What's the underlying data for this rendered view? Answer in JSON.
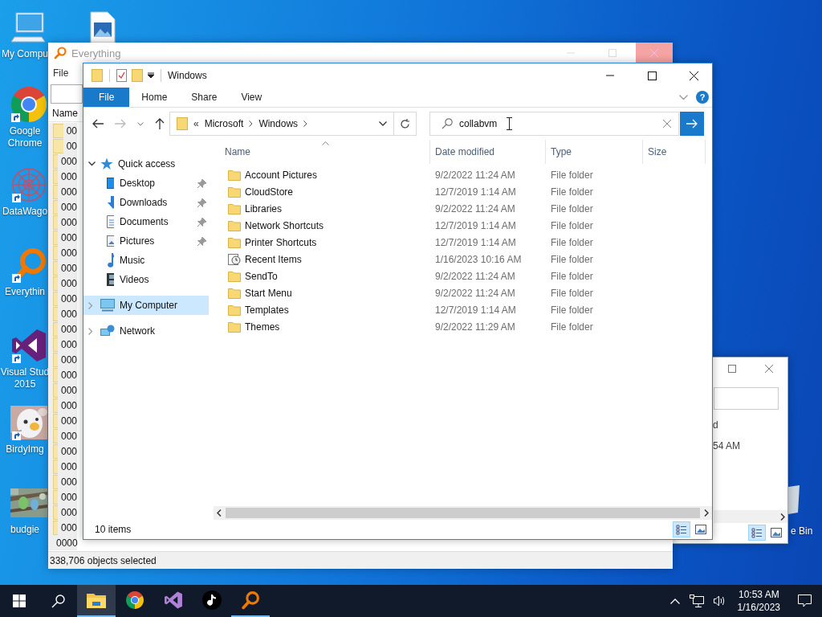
{
  "desktop_icons": [
    {
      "kind": "computer",
      "lines": [
        "My Compu"
      ]
    },
    {
      "kind": "image-file"
    },
    {
      "kind": "chrome",
      "lines": [
        "Google",
        "Chrome"
      ],
      "shortcut": true
    },
    {
      "kind": "datawagon",
      "lines": [
        "DataWago"
      ],
      "shortcut": true
    },
    {
      "kind": "everything",
      "lines": [
        "Everythin"
      ],
      "shortcut": true
    },
    {
      "kind": "visual-studio",
      "lines": [
        "Visual Stud",
        "2015"
      ],
      "shortcut": true
    },
    {
      "kind": "picture",
      "lines": [
        "BirdyImg"
      ],
      "shortcut": true
    },
    {
      "kind": "picture",
      "lines": [
        "budgie"
      ]
    }
  ],
  "recycle_bin": {
    "label": "e Bin"
  },
  "everything_window": {
    "title": "Everything",
    "menu": [
      "File"
    ],
    "column": "Name",
    "rows": [
      {
        "name": "00",
        "selected": true
      },
      {
        "name": "00",
        "selected": true
      },
      {
        "name": "000",
        "selected": true
      },
      {
        "name": "000",
        "selected": true
      },
      {
        "name": "000",
        "selected": true
      },
      {
        "name": "000",
        "selected": true
      },
      {
        "name": "000",
        "selected": true
      },
      {
        "name": "000",
        "selected": true
      },
      {
        "name": "000",
        "selected": true
      },
      {
        "name": "000",
        "selected": true
      },
      {
        "name": "000",
        "selected": true
      },
      {
        "name": "000",
        "selected": true
      },
      {
        "name": "000",
        "selected": true
      },
      {
        "name": "000",
        "selected": true
      },
      {
        "name": "000",
        "selected": true
      },
      {
        "name": "000",
        "selected": true
      },
      {
        "name": "000",
        "selected": true
      },
      {
        "name": "000",
        "selected": true
      },
      {
        "name": "000",
        "selected": true
      },
      {
        "name": "000",
        "selected": true
      },
      {
        "name": "000",
        "selected": true
      },
      {
        "name": "000",
        "selected": true
      },
      {
        "name": "000",
        "selected": true
      },
      {
        "name": "000",
        "selected": true
      },
      {
        "name": "000",
        "selected": true
      },
      {
        "name": "000",
        "selected": true
      },
      {
        "name": "000",
        "selected": true
      },
      {
        "name": "0000",
        "selected": true
      }
    ],
    "status": "338,706 objects selected"
  },
  "back_window": {
    "texts": [
      "d",
      "54 AM"
    ],
    "views": [
      {
        "kind": "details",
        "selected": true
      },
      {
        "kind": "large-icons",
        "selected": false
      }
    ]
  },
  "explorer": {
    "title": "Windows",
    "ribbon_tabs": [
      {
        "label": "File",
        "selected": true
      },
      {
        "label": "Home",
        "selected": false
      },
      {
        "label": "Share",
        "selected": false
      },
      {
        "label": "View",
        "selected": false
      }
    ],
    "help": "?",
    "breadcrumb_overflow": "«",
    "breadcrumb": [
      "Microsoft",
      "Windows"
    ],
    "search": {
      "value": "collabvm"
    },
    "nav": [
      {
        "label": "Quick access",
        "kind": "star",
        "expanded": true,
        "selected": false,
        "children": [
          {
            "label": "Desktop",
            "kind": "desktop",
            "pinned": true
          },
          {
            "label": "Downloads",
            "kind": "download",
            "pinned": true
          },
          {
            "label": "Documents",
            "kind": "documents",
            "pinned": true
          },
          {
            "label": "Pictures",
            "kind": "pictures",
            "pinned": true
          },
          {
            "label": "Music",
            "kind": "music",
            "pinned": false
          },
          {
            "label": "Videos",
            "kind": "videos",
            "pinned": false
          }
        ]
      },
      {
        "label": "My Computer",
        "kind": "computer",
        "expanded": false,
        "selected": true
      },
      {
        "label": "Network",
        "kind": "network",
        "expanded": false,
        "selected": false
      }
    ],
    "columns": [
      "Name",
      "Date modified",
      "Type",
      "Size"
    ],
    "files": [
      {
        "name": "Account Pictures",
        "date": "9/2/2022 11:24 AM",
        "type": "File folder",
        "kind": "folder"
      },
      {
        "name": "CloudStore",
        "date": "12/7/2019 1:14 AM",
        "type": "File folder",
        "kind": "folder"
      },
      {
        "name": "Libraries",
        "date": "9/2/2022 11:24 AM",
        "type": "File folder",
        "kind": "folder"
      },
      {
        "name": "Network Shortcuts",
        "date": "12/7/2019 1:14 AM",
        "type": "File folder",
        "kind": "folder"
      },
      {
        "name": "Printer Shortcuts",
        "date": "12/7/2019 1:14 AM",
        "type": "File folder",
        "kind": "folder"
      },
      {
        "name": "Recent Items",
        "date": "1/16/2023 10:16 AM",
        "type": "File folder",
        "kind": "recent"
      },
      {
        "name": "SendTo",
        "date": "9/2/2022 11:24 AM",
        "type": "File folder",
        "kind": "folder"
      },
      {
        "name": "Start Menu",
        "date": "9/2/2022 11:24 AM",
        "type": "File folder",
        "kind": "folder"
      },
      {
        "name": "Templates",
        "date": "12/7/2019 1:14 AM",
        "type": "File folder",
        "kind": "folder"
      },
      {
        "name": "Themes",
        "date": "9/2/2022 11:29 AM",
        "type": "File folder",
        "kind": "folder"
      }
    ],
    "status": "10 items",
    "views": [
      {
        "kind": "details",
        "selected": true
      },
      {
        "kind": "large-icons",
        "selected": false
      }
    ]
  },
  "taskbar": {
    "apps": [
      {
        "kind": "explorer",
        "selected": true,
        "running": true
      },
      {
        "kind": "chrome",
        "selected": false,
        "running": false
      },
      {
        "kind": "visual-studio",
        "selected": false,
        "running": false
      },
      {
        "kind": "tiktok",
        "selected": false,
        "running": false
      },
      {
        "kind": "everything",
        "selected": false,
        "running": true
      }
    ],
    "time": "10:53 AM",
    "date": "1/16/2023"
  }
}
